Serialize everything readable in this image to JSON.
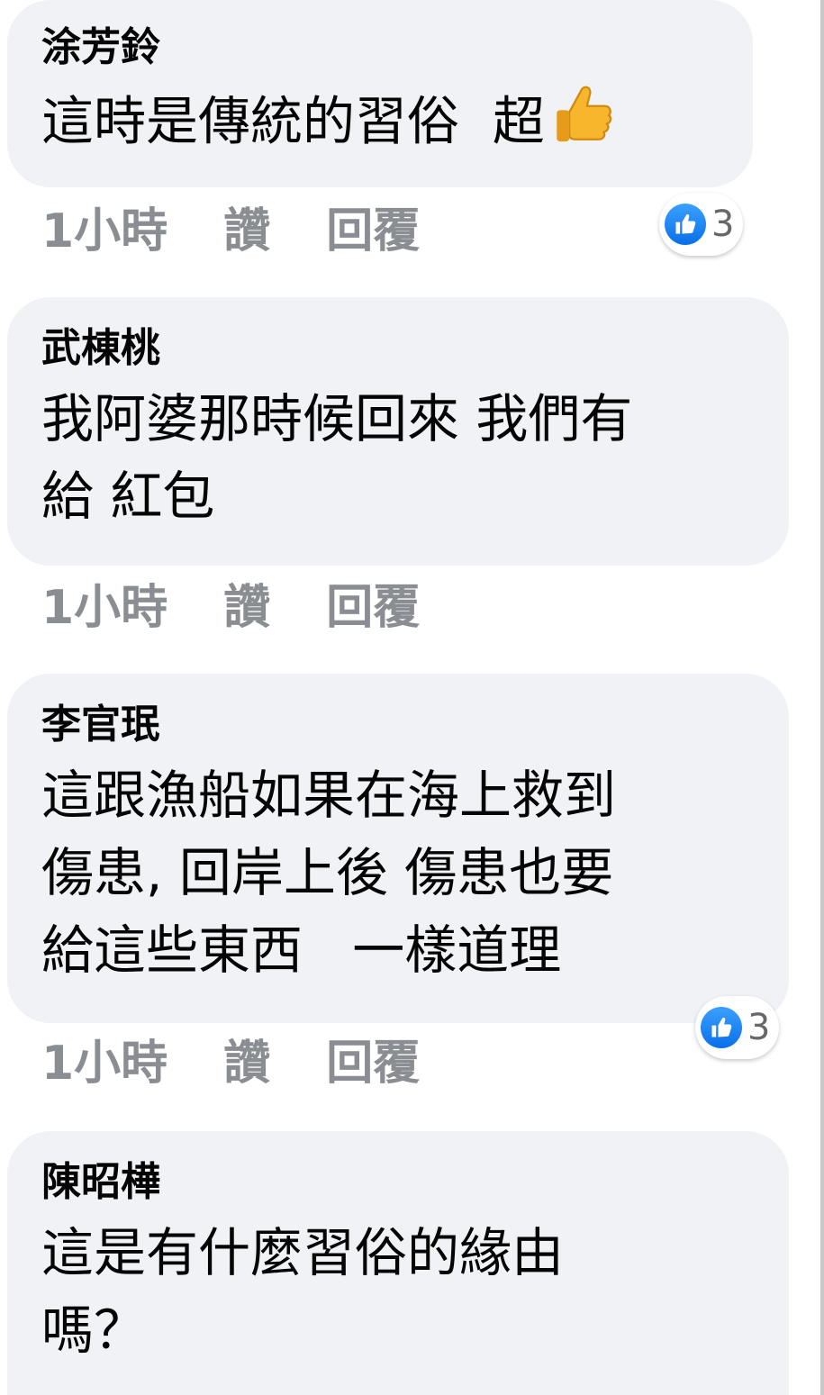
{
  "comments": [
    {
      "author": "涂芳鈴",
      "text": "這時是傳統的習俗  超",
      "emoji": "thumbs-up",
      "time": "1小時",
      "like_label": "讚",
      "reply_label": "回覆",
      "reactions": "3"
    },
    {
      "author": "武棟桃",
      "text": "我阿婆那時候回來 我們有\n給 紅包",
      "time": "1小時",
      "like_label": "讚",
      "reply_label": "回覆"
    },
    {
      "author": "李官珉",
      "text": "這跟漁船如果在海上救到\n傷患, 回岸上後 傷患也要\n給這些東西   一樣道理",
      "time": "1小時",
      "like_label": "讚",
      "reply_label": "回覆",
      "reactions": "3"
    },
    {
      "author": "陳昭樺",
      "text": "這是有什麼習俗的緣由\n嗎？"
    }
  ],
  "colors": {
    "bubble": "#f0f2f5",
    "meta_text": "#8a8d91",
    "like_blue": "#1877f2"
  }
}
